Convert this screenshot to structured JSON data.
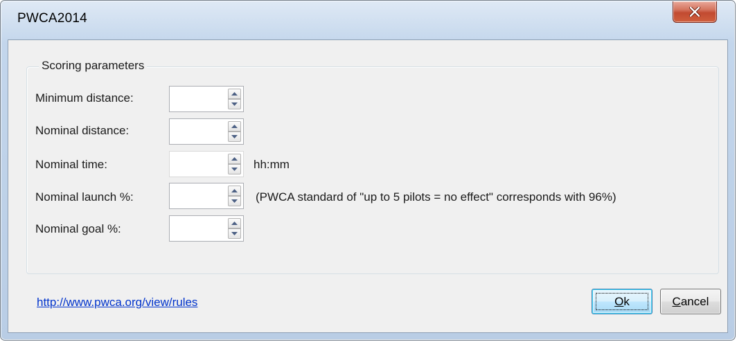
{
  "window": {
    "title": "PWCA2014"
  },
  "group": {
    "legend": "Scoring parameters",
    "params": [
      {
        "label": "Minimum distance:",
        "value": "",
        "hint": "",
        "disabled": false
      },
      {
        "label": "Nominal distance:",
        "value": "",
        "hint": "",
        "disabled": false
      },
      {
        "label": "Nominal time:",
        "value": "",
        "hint": "hh:mm",
        "disabled": true
      },
      {
        "label": "Nominal launch %:",
        "value": "",
        "hint": "(PWCA standard of \"up to 5 pilots = no effect\" corresponds with 96%)",
        "disabled": false
      },
      {
        "label": "Nominal goal %:",
        "value": "",
        "hint": "",
        "disabled": false
      }
    ]
  },
  "footer": {
    "link": "http://www.pwca.org/view/rules",
    "ok_accel": "O",
    "ok_rest": "k",
    "cancel_accel": "C",
    "cancel_rest": "ancel"
  },
  "icons": {
    "close": "close-icon",
    "spin_up": "spin-up-arrow-icon",
    "spin_down": "spin-down-arrow-icon"
  },
  "colors": {
    "link": "#0033cc",
    "close_button": "#c24a31",
    "client_bg": "#f0f0f0"
  }
}
